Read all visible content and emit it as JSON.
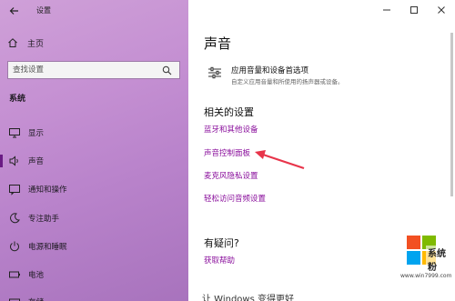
{
  "window": {
    "title": "设置"
  },
  "sidebar": {
    "home_label": "主页",
    "search_placeholder": "查找设置",
    "section_title": "系统",
    "items": [
      {
        "label": "显示",
        "icon": "monitor-icon"
      },
      {
        "label": "声音",
        "icon": "speaker-icon",
        "active": true
      },
      {
        "label": "通知和操作",
        "icon": "notification-icon"
      },
      {
        "label": "专注助手",
        "icon": "moon-icon"
      },
      {
        "label": "电源和睡眠",
        "icon": "power-icon"
      },
      {
        "label": "电池",
        "icon": "battery-icon"
      },
      {
        "label": "存储",
        "icon": "storage-icon"
      }
    ]
  },
  "main": {
    "title": "声音",
    "app_volume": {
      "title": "应用音量和设备首选项",
      "subtitle": "自定义应用音量和所使用的扬声器或设备。"
    },
    "related": {
      "title": "相关的设置",
      "links": [
        "蓝牙和其他设备",
        "声音控制面板",
        "麦克风隐私设置",
        "轻松访问音频设置"
      ]
    },
    "help": {
      "title": "有疑问?",
      "link": "获取帮助"
    },
    "footer": "让 Windows 变得更好"
  },
  "watermark": {
    "brand": "系统粉",
    "url": "www.win7999.com"
  },
  "colors": {
    "link": "#8a0f9c",
    "sidebar_start": "#cfa0d8",
    "sidebar_end": "#a873bd",
    "arrow": "#e8344a"
  }
}
